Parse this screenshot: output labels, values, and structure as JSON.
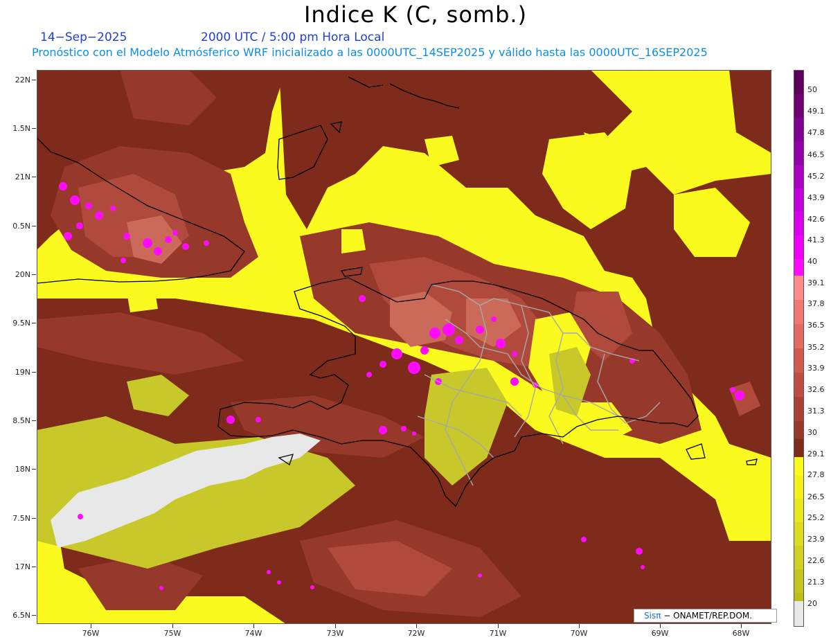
{
  "title": "Indice K (C, somb.)",
  "date": "14−Sep−2025",
  "valid_time": "2000 UTC / 5:00 pm Hora Local",
  "model_line": "Pronóstico con el Modelo Atmósferico WRF inicializado a las 0000UTC_14SEP2025 y válido hasta las  0000UTC_16SEP2025",
  "lat_labels": [
    "22N",
    "1.5N",
    "21N",
    "0.5N",
    "20N",
    "9.5N",
    "19N",
    "8.5N",
    "18N",
    "7.5N",
    "17N",
    "6.5N"
  ],
  "lon_labels": [
    "76W",
    "75W",
    "74W",
    "73W",
    "72W",
    "71W",
    "70W",
    "69W",
    "68W"
  ],
  "colorbar": {
    "labels": [
      "50",
      "49.1",
      "47.8",
      "46.5",
      "45.2",
      "43.9",
      "42.6",
      "41.3",
      "40",
      "39.1",
      "37.8",
      "36.5",
      "35.2",
      "33.9",
      "32.6",
      "31.3",
      "30",
      "29.1",
      "27.8",
      "26.5",
      "25.2",
      "23.9",
      "22.6",
      "21.3",
      "20"
    ],
    "colors": [
      "#5c005c",
      "#6e0070",
      "#7e0090",
      "#9400a8",
      "#a800c0",
      "#c000d8",
      "#d800ec",
      "#ee00f8",
      "#ff0cff",
      "#ff8c8c",
      "#f07a72",
      "#e06c62",
      "#d05c50",
      "#bc4e42",
      "#a84234",
      "#96382a",
      "#7e2b1c",
      "#fafa1e",
      "#f2f21c",
      "#e8e81e",
      "#dcdc22",
      "#d0d024",
      "#c4c422",
      "#bcbc20",
      "#e8e8e8"
    ]
  },
  "credit": {
    "brand": "Sisπ",
    "org": "− ONAMET/REP.DOM."
  },
  "palette": {
    "plot_base": "#fafa1e",
    "dark_brown": "#7e2b1c",
    "mid_brown": "#96382a",
    "light_brown": "#b04a3c",
    "salmon": "#cc6a5a",
    "magenta": "#ff0cff",
    "olive": "#c8c82a",
    "grey_region": "#e8e8e8",
    "coast": "#000000",
    "provinces": "#a8a8a8"
  }
}
